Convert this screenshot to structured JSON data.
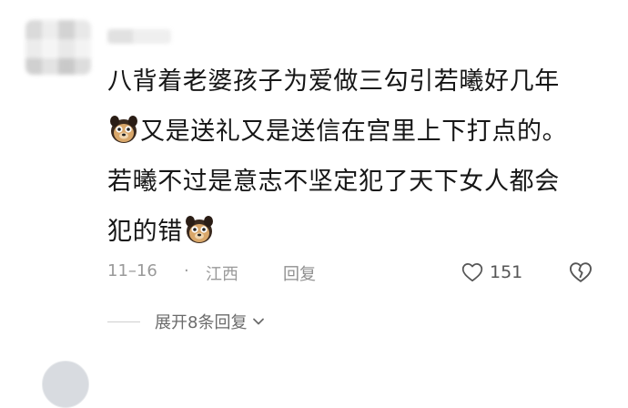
{
  "comment": {
    "lines": [
      "八背着老婆孩子为爱做三勾引若曦好几年",
      "又是送礼又是送信在宫里上下打点的。",
      "若曦不过是意志不坚定犯了天下女人都会",
      "犯的错"
    ],
    "emoji": "dog-emoji"
  },
  "meta": {
    "date": "11–16",
    "separator": "·",
    "location": "江西",
    "reply_label": "回复",
    "like_count": "151"
  },
  "thread": {
    "expand_label": "展开8条回复"
  },
  "colors": {
    "text": "#161616",
    "muted": "#9a9a9a",
    "background": "#ffffff"
  }
}
